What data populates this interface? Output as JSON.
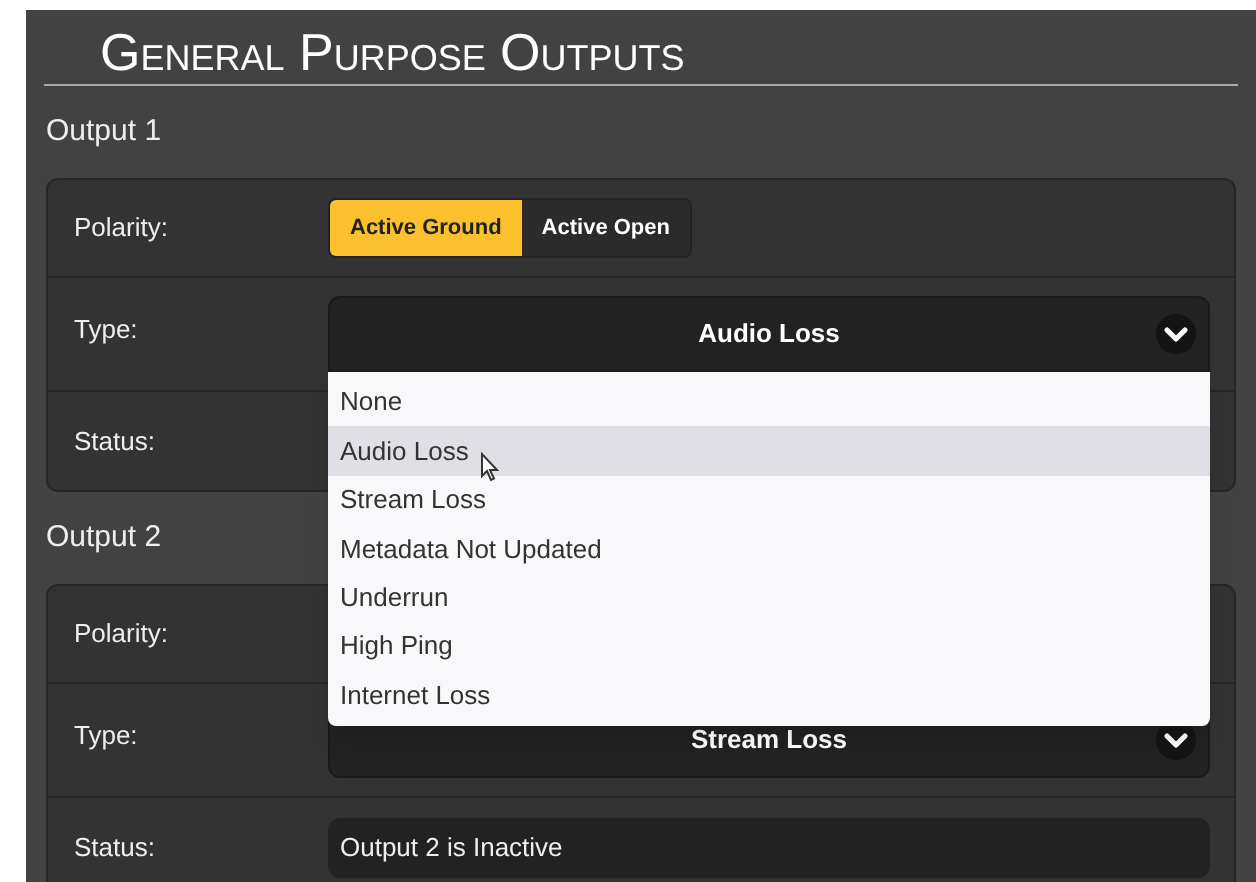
{
  "title": "General Purpose Outputs",
  "outputs": [
    {
      "label": "Output 1",
      "polarity": {
        "label": "Polarity:",
        "options": [
          {
            "label": "Active Ground",
            "selected": true
          },
          {
            "label": "Active Open",
            "selected": false
          }
        ]
      },
      "type": {
        "label": "Type:",
        "value": "Audio Loss",
        "expanded": true,
        "options": [
          {
            "label": "None",
            "selected": false
          },
          {
            "label": "Audio Loss",
            "selected": true
          },
          {
            "label": "Stream Loss",
            "selected": false
          },
          {
            "label": "Metadata Not Updated",
            "selected": false
          },
          {
            "label": "Underrun",
            "selected": false
          },
          {
            "label": "High Ping",
            "selected": false
          },
          {
            "label": "Internet Loss",
            "selected": false
          }
        ]
      },
      "status": {
        "label": "Status:"
      }
    },
    {
      "label": "Output 2",
      "polarity": {
        "label": "Polarity:"
      },
      "type": {
        "label": "Type:",
        "value": "Stream Loss",
        "expanded": false
      },
      "status": {
        "label": "Status:",
        "value": "Output 2 is Inactive"
      }
    }
  ]
}
